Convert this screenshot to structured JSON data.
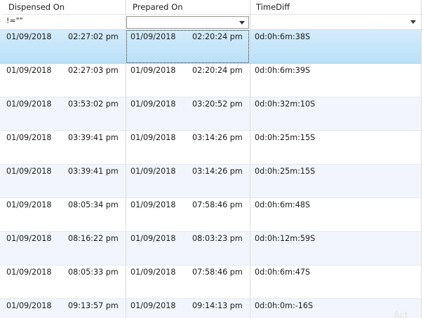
{
  "columns": [
    "Dispensed On",
    "Prepared On",
    "TimeDiff"
  ],
  "filters": {
    "dispensed": "!=\"\"",
    "prepared": "",
    "timediff": ""
  },
  "rows": [
    {
      "d_date": "01/09/2018",
      "d_time": "02:27:02 pm",
      "p_date": "01/09/2018",
      "p_time": "02:20:24 pm",
      "diff": "0d:0h:6m:38S"
    },
    {
      "d_date": "01/09/2018",
      "d_time": "02:27:03 pm",
      "p_date": "01/09/2018",
      "p_time": "02:20:24 pm",
      "diff": "0d:0h:6m:39S"
    },
    {
      "d_date": "01/09/2018",
      "d_time": "03:53:02 pm",
      "p_date": "01/09/2018",
      "p_time": "03:20:52 pm",
      "diff": "0d:0h:32m:10S"
    },
    {
      "d_date": "01/09/2018",
      "d_time": "03:39:41 pm",
      "p_date": "01/09/2018",
      "p_time": "03:14:26 pm",
      "diff": "0d:0h:25m:15S"
    },
    {
      "d_date": "01/09/2018",
      "d_time": "03:39:41 pm",
      "p_date": "01/09/2018",
      "p_time": "03:14:26 pm",
      "diff": "0d:0h:25m:15S"
    },
    {
      "d_date": "01/09/2018",
      "d_time": "08:05:34 pm",
      "p_date": "01/09/2018",
      "p_time": "07:58:46 pm",
      "diff": "0d:0h:6m:48S"
    },
    {
      "d_date": "01/09/2018",
      "d_time": "08:16:22 pm",
      "p_date": "01/09/2018",
      "p_time": "08:03:23 pm",
      "diff": "0d:0h:12m:59S"
    },
    {
      "d_date": "01/09/2018",
      "d_time": "08:05:33 pm",
      "p_date": "01/09/2018",
      "p_time": "07:58:46 pm",
      "diff": "0d:0h:6m:47S"
    },
    {
      "d_date": "01/09/2018",
      "d_time": "09:13:57 pm",
      "p_date": "01/09/2018",
      "p_time": "09:14:13 pm",
      "diff": "0d:0h:0m:-16S"
    }
  ],
  "selected_row": 0,
  "colors": {
    "selection": "#c4e6fa",
    "alt_row": "#f2f6fc",
    "grid_line": "#dcdcdc"
  },
  "icons": {
    "dropdown": "chevron-down-icon"
  },
  "watermark": "Act"
}
